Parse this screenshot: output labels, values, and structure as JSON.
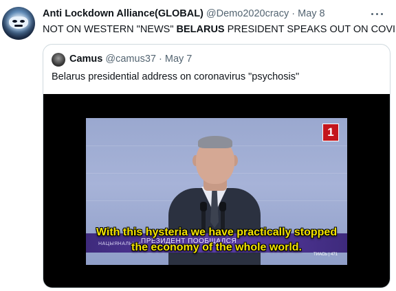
{
  "tweet": {
    "author_name": "Anti Lockdown Alliance(GLOBAL)",
    "author_handle": "@Demo2020cracy",
    "separator": "·",
    "date": "May 8",
    "text_part1": "NOT ON WESTERN \"NEWS\" ",
    "text_bold": "BELARUS",
    "text_part2": " PRESIDENT SPEAKS OUT ON COVID",
    "more_icon": "more-horizontal-icon"
  },
  "quote": {
    "author_name": "Camus",
    "author_handle": "@camus37",
    "separator": "·",
    "date": "May 7",
    "text": "Belarus presidential address on coronavirus \"psychosis\"",
    "video": {
      "channel_logo": "1",
      "lower_third_small": "НАЦЫЯНАЛЬНЫ",
      "lower_third_main": "ПРЕЗИДЕНТ ПООБЩАЛСЯ",
      "lower_third_right": "ТИАСЬ | 471",
      "subtitle_line1": "With this hysteria we have practically stopped",
      "subtitle_line2": "the economy of the whole world."
    }
  },
  "colors": {
    "text_primary": "#0f1419",
    "text_secondary": "#536471",
    "border": "#cfd9de",
    "subtitle_yellow": "#f5e400",
    "channel_red": "#c4161c",
    "lower_third_purple": "#5b3ea8"
  }
}
